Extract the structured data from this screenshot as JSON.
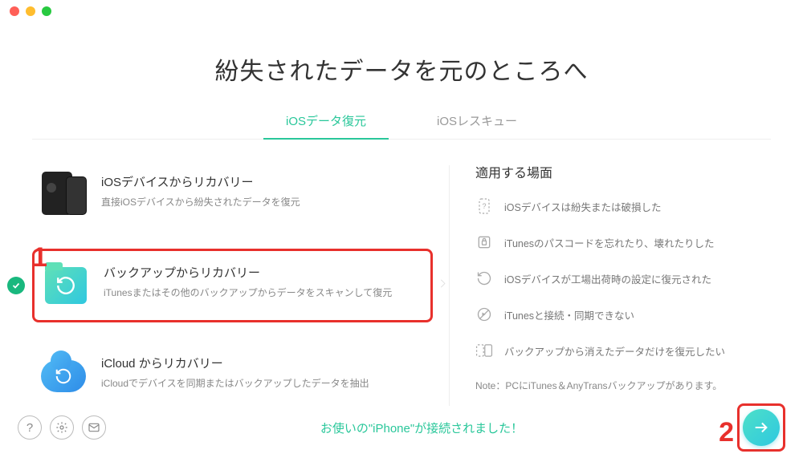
{
  "header": {
    "title": "紛失されたデータを元のところへ"
  },
  "tabs": [
    {
      "label": "iOSデータ復元",
      "active": true
    },
    {
      "label": "iOSレスキュー",
      "active": false
    }
  ],
  "options": [
    {
      "title": "iOSデバイスからリカバリー",
      "desc": "直接iOSデバイスから紛失されたデータを復元",
      "selected": false
    },
    {
      "title": "バックアップからリカバリー",
      "desc": "iTunesまたはその他のバックアップからデータをスキャンして復元",
      "selected": true
    },
    {
      "title": "iCloud からリカバリー",
      "desc": "iCloudでデバイスを同期またはバックアップしたデータを抽出",
      "selected": false
    }
  ],
  "right": {
    "heading": "適用する場面",
    "scenarios": [
      "iOSデバイスは紛失または破損した",
      "iTunesのパスコードを忘れたり、壊れたりした",
      "iOSデバイスが工場出荷時の設定に復元された",
      "iTunesと接続・同期できない",
      "バックアップから消えたデータだけを復元したい"
    ],
    "note": "Note：PCにiTunes＆AnyTransバックアップがあります。"
  },
  "footer": {
    "status": "お使いの\"iPhone\"が接続されました！"
  },
  "annotations": {
    "step1": "1",
    "step2": "2"
  }
}
